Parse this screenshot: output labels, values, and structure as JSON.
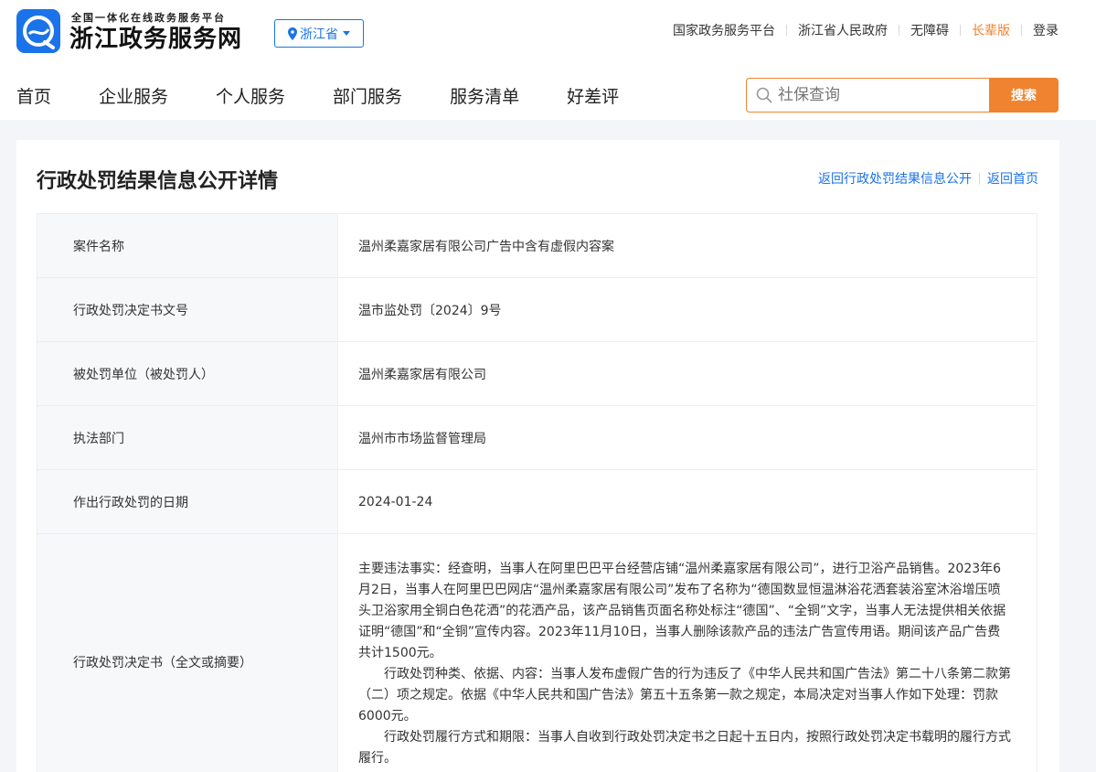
{
  "header": {
    "logo_subtitle": "全国一体化在线政务服务平台",
    "logo_title": "浙江政务服务网",
    "region": "浙江省",
    "top_links": [
      "国家政务服务平台",
      "浙江省人民政府",
      "无障碍",
      "长辈版",
      "登录"
    ],
    "nav": [
      "首页",
      "企业服务",
      "个人服务",
      "部门服务",
      "服务清单",
      "好差评"
    ],
    "search": {
      "placeholder": "社保查询",
      "button": "搜索"
    }
  },
  "main": {
    "title": "行政处罚结果信息公开详情",
    "links": [
      "返回行政处罚结果信息公开",
      "返回首页"
    ],
    "rows": [
      {
        "label": "案件名称",
        "value": "温州柔嘉家居有限公司广告中含有虚假内容案"
      },
      {
        "label": "行政处罚决定书文号",
        "value": "温市监处罚〔2024〕9号"
      },
      {
        "label": "被处罚单位（被处罚人）",
        "value": "温州柔嘉家居有限公司"
      },
      {
        "label": "执法部门",
        "value": "温州市市场监督管理局"
      },
      {
        "label": "作出行政处罚的日期",
        "value": "2024-01-24"
      }
    ],
    "decision": {
      "label": "行政处罚决定书（全文或摘要）",
      "paragraphs": [
        "主要违法事实：经查明，当事人在阿里巴巴平台经营店铺“温州柔嘉家居有限公司”，进行卫浴产品销售。2023年6月2日，当事人在阿里巴巴网店“温州柔嘉家居有限公司”发布了名称为“德国数显恒温淋浴花洒套装浴室沐浴增压喷头卫浴家用全铜白色花洒”的花洒产品，该产品销售页面名称处标注“德国”、“全铜”文字，当事人无法提供相关依据证明“德国”和“全铜”宣传内容。2023年11月10日，当事人删除该款产品的违法广告宣传用语。期间该产品广告费共计1500元。",
        "行政处罚种类、依据、内容：当事人发布虚假广告的行为违反了《中华人民共和国广告法》第二十八条第二款第（二）项之规定。依据《中华人民共和国广告法》第五十五条第一款之规定，本局决定对当事人作如下处理：罚款6000元。",
        "行政处罚履行方式和期限：当事人自收到行政处罚决定书之日起十五日内，按照行政处罚决定书载明的履行方式履行。"
      ]
    }
  },
  "colors": {
    "brand_blue": "#1a73e8",
    "accent_orange": "#f0832f",
    "page_bg": "#f3f5f8"
  },
  "icons": {
    "logo": "zhejiang-logo-icon",
    "region": "location-pin-icon",
    "dropdown": "caret-down-icon",
    "search": "search-icon"
  }
}
